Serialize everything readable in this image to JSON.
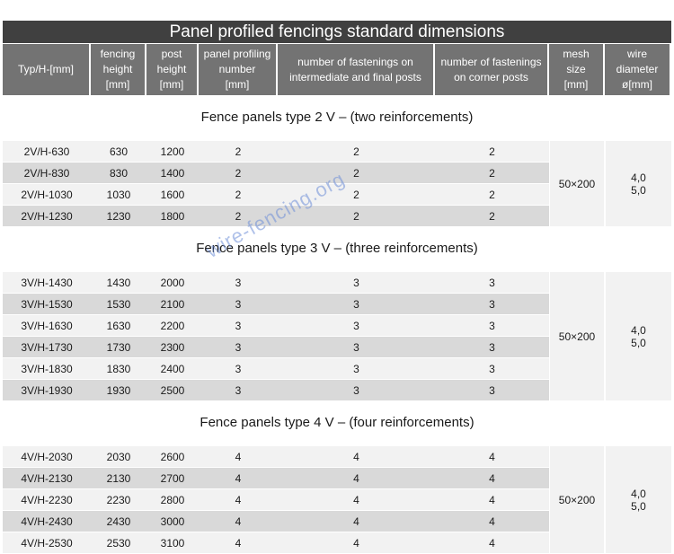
{
  "title": "Panel profiled fencings standard dimensions",
  "headers": [
    "Typ/H-[mm]",
    "fencing\nheight\n[mm]",
    "post\nheight\n[mm]",
    "panel profiling\nnumber\n[mm]",
    "number of fastenings on\nintermediate and final posts",
    "number of fastenings\non corner posts",
    "mesh\nsize\n[mm]",
    "wire\ndiameter\nø[mm]"
  ],
  "sections": [
    {
      "title": "Fence panels type 2 V – (two reinforcements)",
      "mesh_size": "50×200",
      "wire_diameter": "4,0\n5,0",
      "rows": [
        [
          "2V/H-630",
          "630",
          "1200",
          "2",
          "2",
          "2"
        ],
        [
          "2V/H-830",
          "830",
          "1400",
          "2",
          "2",
          "2"
        ],
        [
          "2V/H-1030",
          "1030",
          "1600",
          "2",
          "2",
          "2"
        ],
        [
          "2V/H-1230",
          "1230",
          "1800",
          "2",
          "2",
          "2"
        ]
      ]
    },
    {
      "title": "Fence panels type 3 V – (three reinforcements)",
      "mesh_size": "50×200",
      "wire_diameter": "4,0\n5,0",
      "rows": [
        [
          "3V/H-1430",
          "1430",
          "2000",
          "3",
          "3",
          "3"
        ],
        [
          "3V/H-1530",
          "1530",
          "2100",
          "3",
          "3",
          "3"
        ],
        [
          "3V/H-1630",
          "1630",
          "2200",
          "3",
          "3",
          "3"
        ],
        [
          "3V/H-1730",
          "1730",
          "2300",
          "3",
          "3",
          "3"
        ],
        [
          "3V/H-1830",
          "1830",
          "2400",
          "3",
          "3",
          "3"
        ],
        [
          "3V/H-1930",
          "1930",
          "2500",
          "3",
          "3",
          "3"
        ]
      ]
    },
    {
      "title": "Fence panels type 4 V – (four reinforcements)",
      "mesh_size": "50×200",
      "wire_diameter": "4,0\n5,0",
      "rows": [
        [
          "4V/H-2030",
          "2030",
          "2600",
          "4",
          "4",
          "4"
        ],
        [
          "4V/H-2130",
          "2130",
          "2700",
          "4",
          "4",
          "4"
        ],
        [
          "4V/H-2230",
          "2230",
          "2800",
          "4",
          "4",
          "4"
        ],
        [
          "4V/H-2430",
          "2430",
          "3000",
          "4",
          "4",
          "4"
        ],
        [
          "4V/H-2530",
          "2530",
          "3100",
          "4",
          "4",
          "4"
        ]
      ]
    }
  ],
  "watermark": "wire-fencing.org"
}
